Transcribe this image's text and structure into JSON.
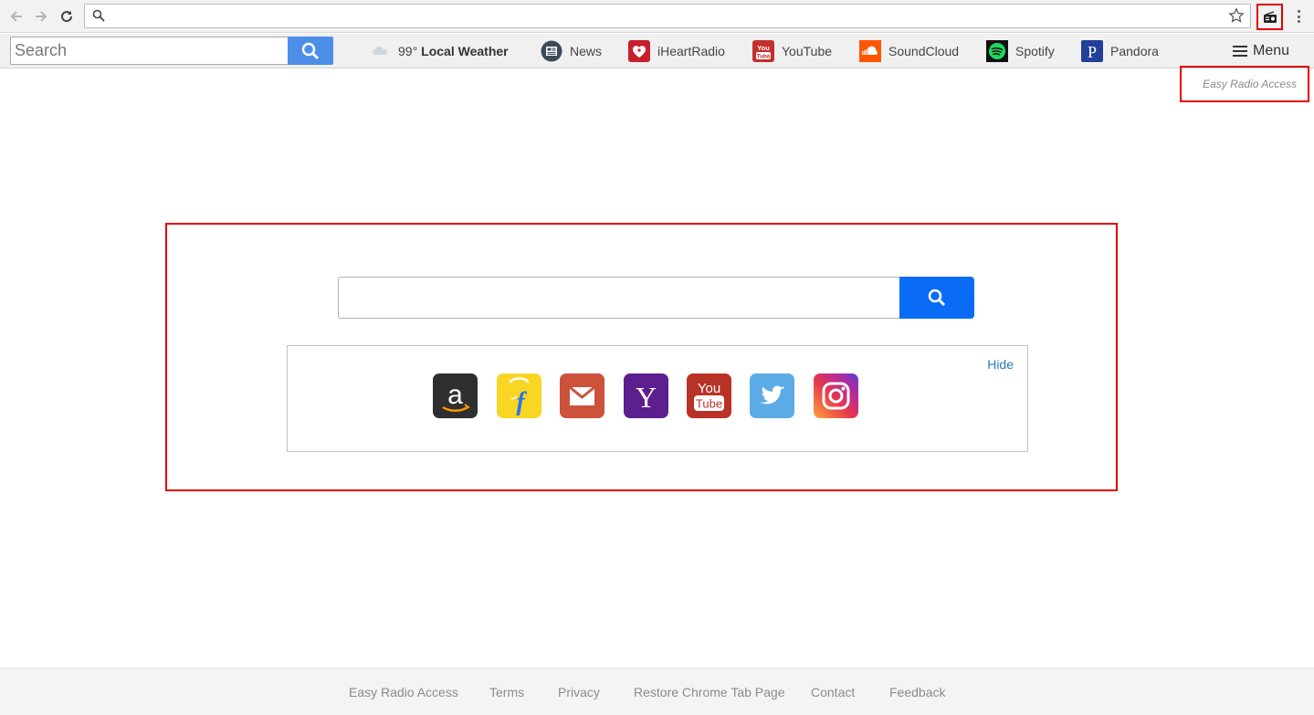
{
  "browser": {
    "omnibox_value": "",
    "extension_icon": "radio-icon"
  },
  "toolbar": {
    "search_placeholder": "Search",
    "weather_temp": "99°",
    "weather_label": "Local Weather",
    "links": [
      "News",
      "iHeartRadio",
      "YouTube",
      "SoundCloud",
      "Spotify",
      "Pandora"
    ],
    "menu_label": "Menu"
  },
  "brand": "Easy Radio Access",
  "main": {
    "search_value": "",
    "hide_label": "Hide",
    "tiles": [
      "amazon-icon",
      "flipkart-icon",
      "gmail-icon",
      "yahoo-icon",
      "youtube-icon",
      "twitter-icon",
      "instagram-icon"
    ]
  },
  "footer": {
    "links": [
      "Easy Radio Access",
      "Terms",
      "Privacy",
      "Restore Chrome Tab Page",
      "Contact",
      "Feedback"
    ]
  },
  "colors": {
    "highlight": "#e00000",
    "search_button": "#0a6cf5",
    "toolbar_search_button": "#4d8fe8",
    "link": "#2a7bbf"
  }
}
